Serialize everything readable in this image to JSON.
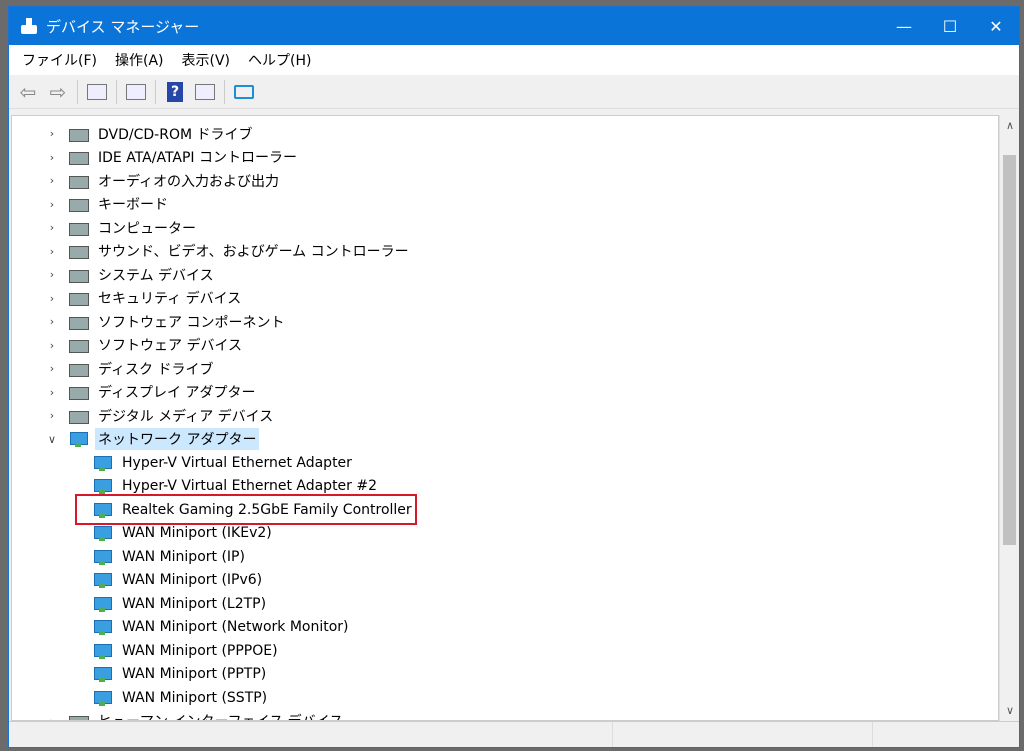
{
  "window": {
    "title": "デバイス マネージャー",
    "minimize": "—",
    "maximize": "☐",
    "close": "✕"
  },
  "menu": [
    "ファイル(F)",
    "操作(A)",
    "表示(V)",
    "ヘルプ(H)"
  ],
  "toolbar": [
    "back",
    "forward",
    "show-hide-console-tree",
    "properties",
    "help",
    "run",
    "scan-hardware"
  ],
  "tree": {
    "categories_before": [
      "DVD/CD-ROM ドライブ",
      "IDE ATA/ATAPI コントローラー",
      "オーディオの入力および出力",
      "キーボード",
      "コンピューター",
      "サウンド、ビデオ、およびゲーム コントローラー",
      "システム デバイス",
      "セキュリティ デバイス",
      "ソフトウェア コンポーネント",
      "ソフトウェア デバイス",
      "ディスク ドライブ",
      "ディスプレイ アダプター",
      "デジタル メディア デバイス"
    ],
    "expanded": {
      "label": "ネットワーク アダプター",
      "children": [
        "Hyper-V Virtual Ethernet Adapter",
        "Hyper-V Virtual Ethernet Adapter #2",
        "Realtek Gaming 2.5GbE Family Controller",
        "WAN Miniport (IKEv2)",
        "WAN Miniport (IP)",
        "WAN Miniport (IPv6)",
        "WAN Miniport (L2TP)",
        "WAN Miniport (Network Monitor)",
        "WAN Miniport (PPPOE)",
        "WAN Miniport (PPTP)",
        "WAN Miniport (SSTP)"
      ]
    },
    "categories_after": [
      "ヒューマン インターフェイス デバイス"
    ],
    "highlighted": "Realtek Gaming 2.5GbE Family Controller"
  },
  "colors": {
    "titlebar": "#0a74d8",
    "highlight_box": "#d7182a",
    "selection": "#cce8ff"
  }
}
